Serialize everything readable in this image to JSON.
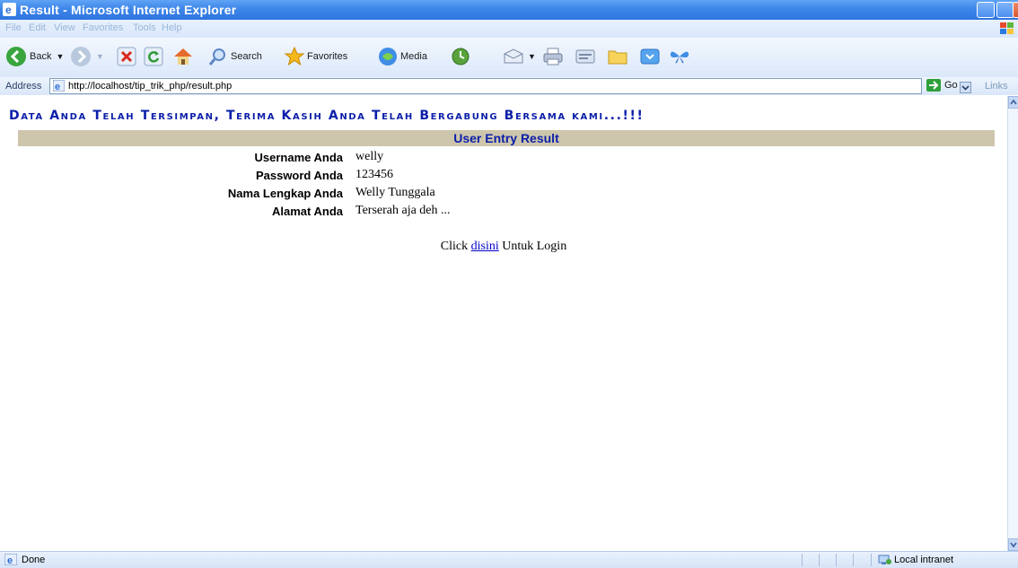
{
  "window": {
    "title": "Result - Microsoft Internet Explorer"
  },
  "menu": [
    "File",
    "Edit",
    "View",
    "Favorites",
    "Tools",
    "Help"
  ],
  "toolbar": {
    "back_label": "Back",
    "search_label": "Search",
    "favorites_label": "Favorites",
    "media_label": "Media"
  },
  "address": {
    "label": "Address",
    "url": "http://localhost/tip_trik_php/result.php",
    "go_label": "Go",
    "links_label": "Links"
  },
  "page": {
    "heading": "Data Anda Telah Tersimpan, Terima Kasih Anda Telah Bergabung Bersama kami...!!!",
    "table_title": "User Entry Result",
    "rows": [
      {
        "label": "Username Anda",
        "value": "welly"
      },
      {
        "label": "Password Anda",
        "value": "123456"
      },
      {
        "label": "Nama Lengkap Anda",
        "value": "Welly Tunggala"
      },
      {
        "label": "Alamat Anda",
        "value": "Terserah aja deh ..."
      }
    ],
    "login": {
      "prefix": "Click",
      "link_text": "disini",
      "suffix": "Untuk Login"
    }
  },
  "status": {
    "text": "Done",
    "zone": "Local intranet"
  }
}
